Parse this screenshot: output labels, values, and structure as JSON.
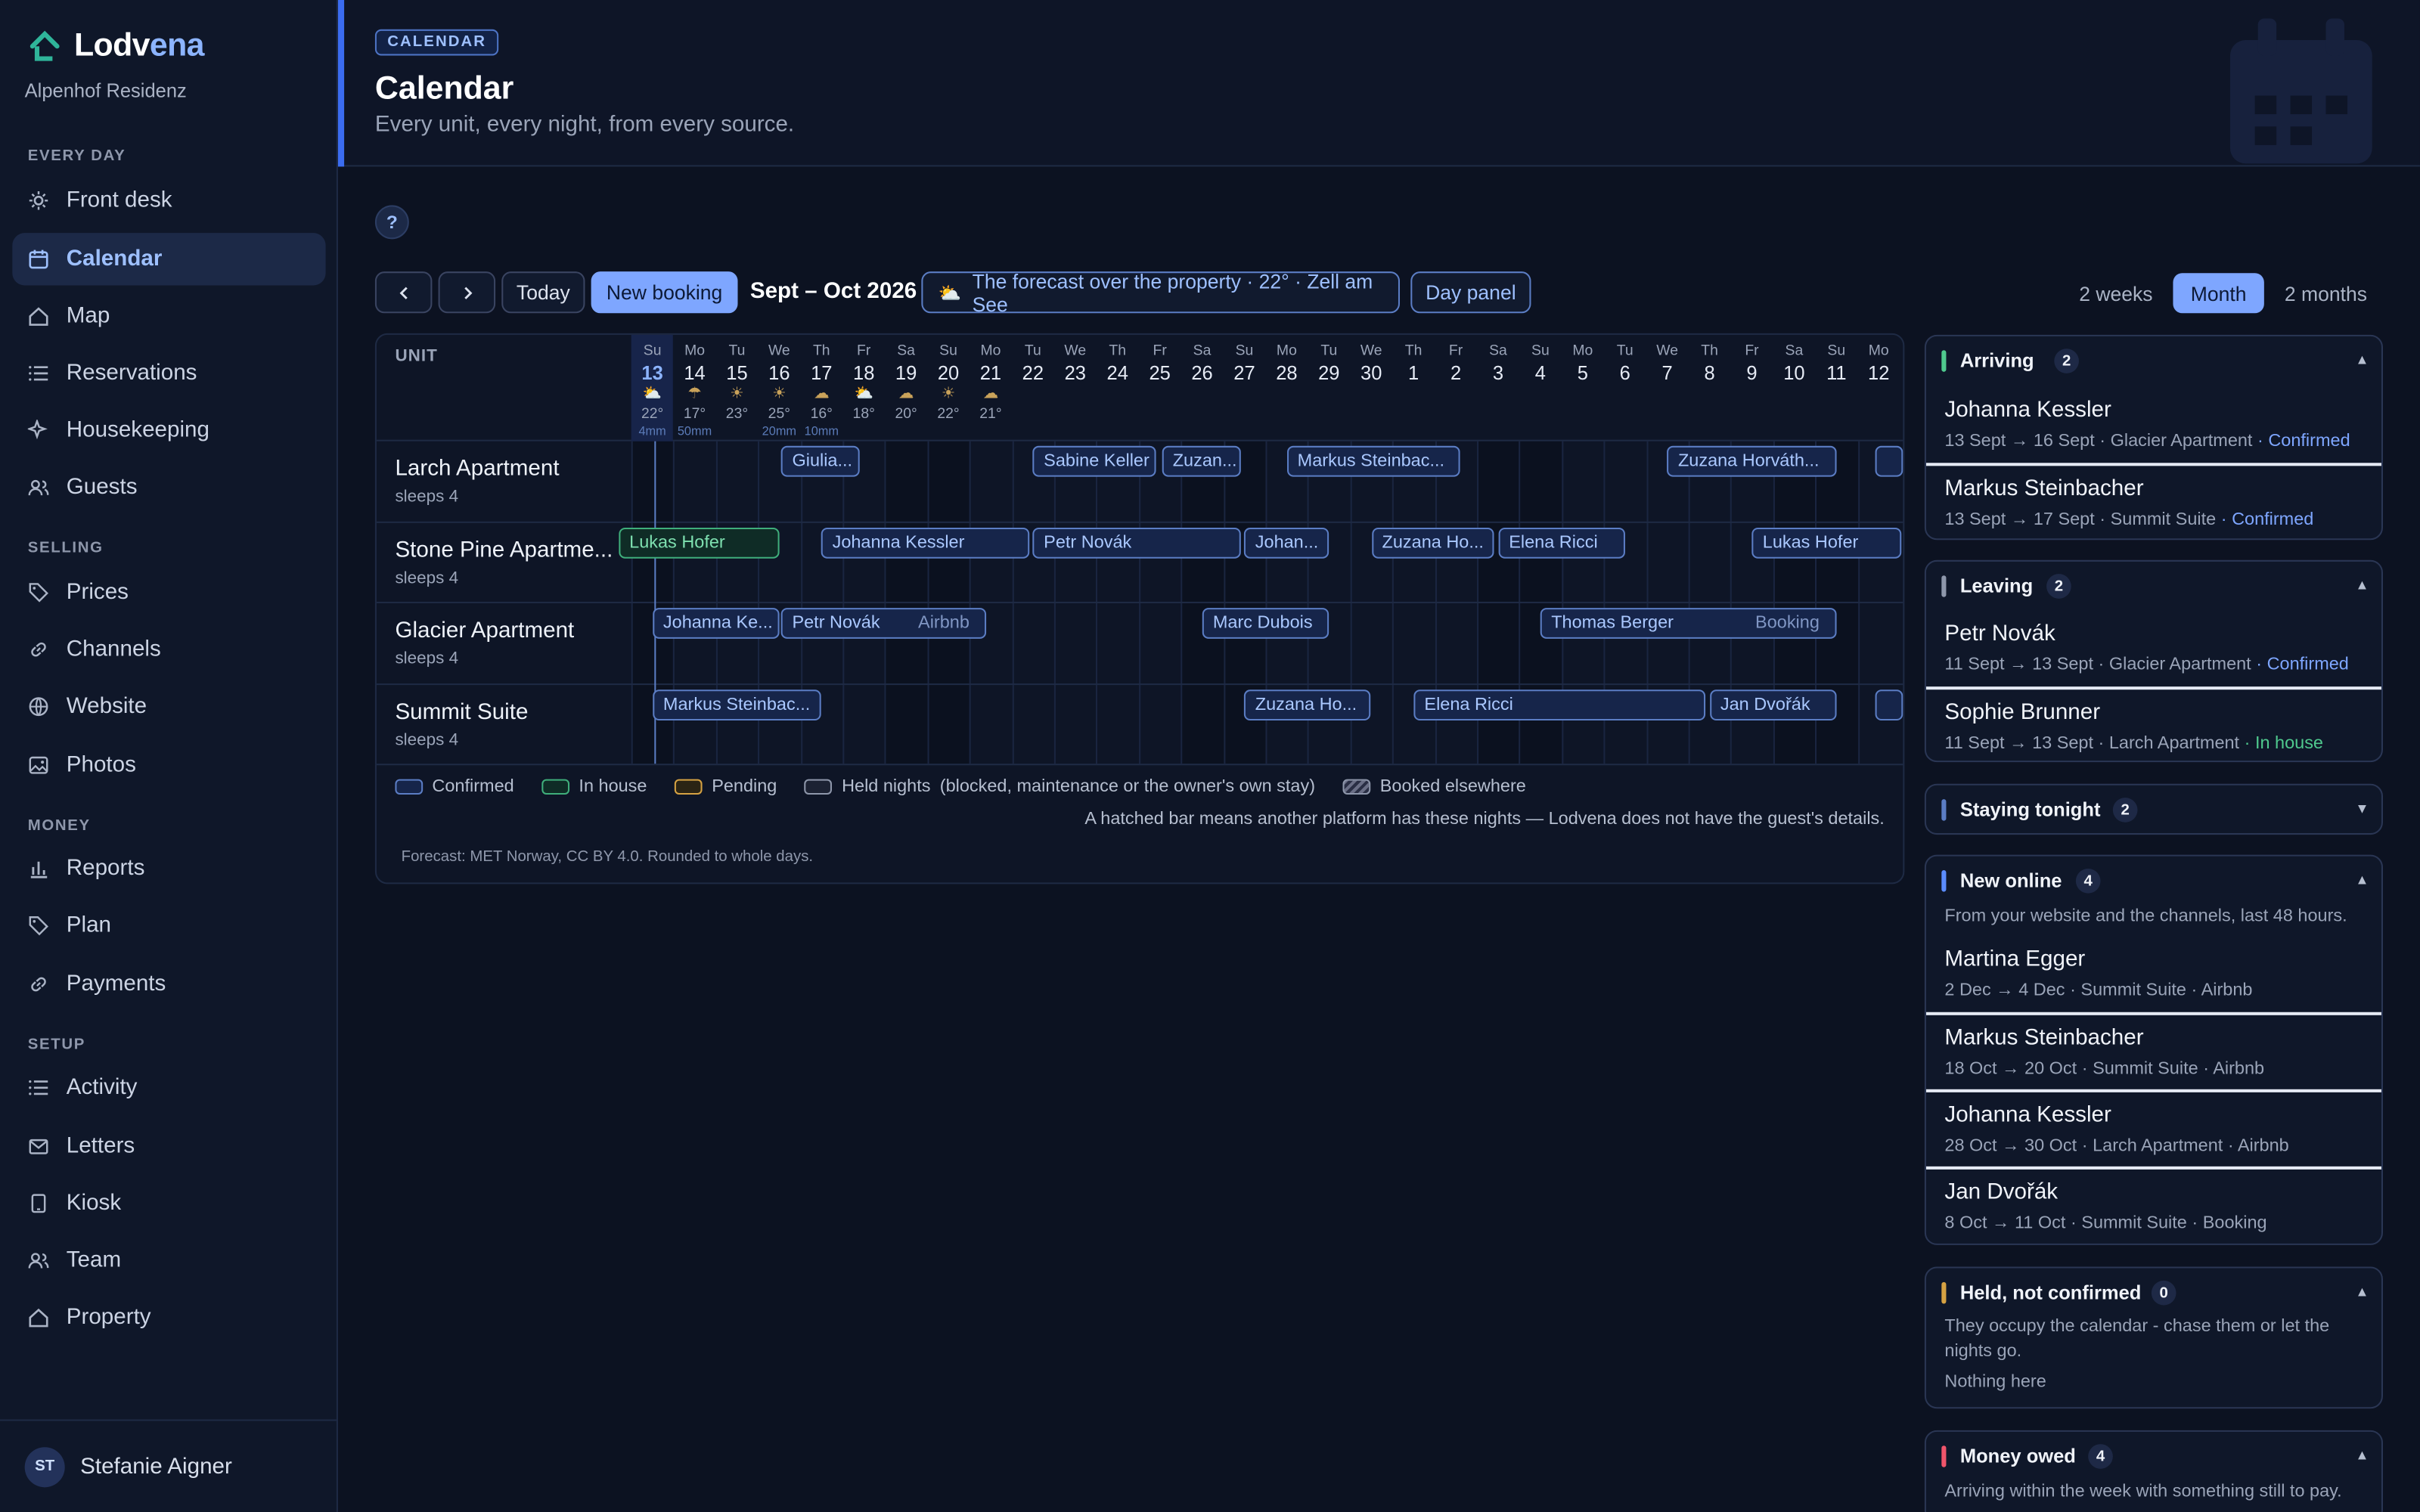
{
  "app": {
    "brand_a": "Lodv",
    "brand_b": "ena",
    "property": "Alpenhof Residenz"
  },
  "sidebar": {
    "sections": {
      "every_day": "EVERY DAY",
      "selling": "SELLING",
      "money": "MONEY",
      "setup": "SETUP"
    },
    "items": [
      {
        "label": "Front desk"
      },
      {
        "label": "Calendar"
      },
      {
        "label": "Map"
      },
      {
        "label": "Reservations"
      },
      {
        "label": "Housekeeping"
      },
      {
        "label": "Guests"
      },
      {
        "label": "Prices"
      },
      {
        "label": "Channels"
      },
      {
        "label": "Website"
      },
      {
        "label": "Photos"
      },
      {
        "label": "Reports"
      },
      {
        "label": "Plan"
      },
      {
        "label": "Payments"
      },
      {
        "label": "Activity"
      },
      {
        "label": "Letters"
      },
      {
        "label": "Kiosk"
      },
      {
        "label": "Team"
      },
      {
        "label": "Property"
      }
    ],
    "user": {
      "initials": "ST",
      "name": "Stefanie Aigner"
    }
  },
  "header": {
    "badge": "CALENDAR",
    "title": "Calendar",
    "subtitle": "Every unit, every night, from every source."
  },
  "toolbar": {
    "help": "?",
    "prev": "‹",
    "next": "›",
    "today": "Today",
    "new_booking": "New booking",
    "range": "Sept – Oct 2026",
    "forecast": "The forecast over the property · 22° · Zell am See",
    "day_panel": "Day panel",
    "views": [
      "2 weeks",
      "Month",
      "2 months"
    ],
    "selected_view": "Month"
  },
  "grid": {
    "unit_header": "UNIT",
    "days": [
      {
        "w": "Su",
        "n": "13",
        "wx": "⛅",
        "t": "22°",
        "p": "4mm"
      },
      {
        "w": "Mo",
        "n": "14",
        "wx": "☂",
        "t": "17°",
        "p": "50mm"
      },
      {
        "w": "Tu",
        "n": "15",
        "wx": "☀",
        "t": "23°",
        "p": ""
      },
      {
        "w": "We",
        "n": "16",
        "wx": "☀",
        "t": "25°",
        "p": "20mm"
      },
      {
        "w": "Th",
        "n": "17",
        "wx": "☁",
        "t": "16°",
        "p": "10mm"
      },
      {
        "w": "Fr",
        "n": "18",
        "wx": "⛅",
        "t": "18°",
        "p": ""
      },
      {
        "w": "Sa",
        "n": "19",
        "wx": "☁",
        "t": "20°",
        "p": ""
      },
      {
        "w": "Su",
        "n": "20",
        "wx": "☀",
        "t": "22°",
        "p": ""
      },
      {
        "w": "Mo",
        "n": "21",
        "wx": "☁",
        "t": "21°",
        "p": ""
      },
      {
        "w": "Tu",
        "n": "22"
      },
      {
        "w": "We",
        "n": "23"
      },
      {
        "w": "Th",
        "n": "24"
      },
      {
        "w": "Fr",
        "n": "25"
      },
      {
        "w": "Sa",
        "n": "26"
      },
      {
        "w": "Su",
        "n": "27"
      },
      {
        "w": "Mo",
        "n": "28"
      },
      {
        "w": "Tu",
        "n": "29"
      },
      {
        "w": "We",
        "n": "30"
      },
      {
        "w": "Th",
        "n": "1"
      },
      {
        "w": "Fr",
        "n": "2"
      },
      {
        "w": "Sa",
        "n": "3"
      },
      {
        "w": "Su",
        "n": "4"
      },
      {
        "w": "Mo",
        "n": "5"
      },
      {
        "w": "Tu",
        "n": "6"
      },
      {
        "w": "We",
        "n": "7"
      },
      {
        "w": "Th",
        "n": "8"
      },
      {
        "w": "Fr",
        "n": "9"
      },
      {
        "w": "Sa",
        "n": "10"
      },
      {
        "w": "Su",
        "n": "11"
      },
      {
        "w": "Mo",
        "n": "12"
      }
    ],
    "units": [
      {
        "name": "Larch Apartment",
        "sleeps": "sleeps 4"
      },
      {
        "name": "Stone Pine Apartme...",
        "sleeps": "sleeps 4"
      },
      {
        "name": "Glacier Apartment",
        "sleeps": "sleeps 4"
      },
      {
        "name": "Summit Suite",
        "sleeps": "sleeps 4"
      }
    ],
    "bookings": [
      {
        "guest": "Giulia...",
        "source": ""
      },
      {
        "guest": "Sabine Keller",
        "source": ""
      },
      {
        "guest": "Zuzan...",
        "source": ""
      },
      {
        "guest": "Markus Steinbac...",
        "source": ""
      },
      {
        "guest": "Zuzana Horváth...",
        "source": ""
      },
      {
        "guest": "",
        "source": ""
      },
      {
        "guest": "Lukas Hofer",
        "source": ""
      },
      {
        "guest": "Johanna Kessler",
        "source": ""
      },
      {
        "guest": "Petr Novák",
        "source": ""
      },
      {
        "guest": "Johan...",
        "source": ""
      },
      {
        "guest": "Zuzana Ho...",
        "source": ""
      },
      {
        "guest": "Elena Ricci",
        "source": ""
      },
      {
        "guest": "Lukas Hofer",
        "source": ""
      },
      {
        "guest": "Johanna Ke...",
        "source": ""
      },
      {
        "guest": "Petr Novák",
        "source": "Airbnb"
      },
      {
        "guest": "Marc Dubois",
        "source": ""
      },
      {
        "guest": "Thomas Berger",
        "source": "Booking"
      },
      {
        "guest": "Markus Steinbac...",
        "source": ""
      },
      {
        "guest": "Zuzana Ho...",
        "source": ""
      },
      {
        "guest": "Elena Ricci",
        "source": ""
      },
      {
        "guest": "Jan Dvořák",
        "source": ""
      },
      {
        "guest": "",
        "source": ""
      }
    ]
  },
  "legend": {
    "confirmed": "Confirmed",
    "in_house": "In house",
    "pending": "Pending",
    "held": "Held nights",
    "held_note": "(blocked, maintenance or the owner's own stay)",
    "elsewhere": "Booked elsewhere",
    "hatch_note": "A hatched bar means another platform has these nights — Lodvena does not have the guest's details.",
    "forecast_note": "Forecast: MET Norway, CC BY 4.0. Rounded to whole days."
  },
  "panels": {
    "arriving": {
      "title": "Arriving",
      "count": "2",
      "items": [
        {
          "name": "Johanna Kessler",
          "dates": "13 Sept → 16 Sept",
          "unit": "· Glacier Apartment",
          "status": "· Confirmed"
        },
        {
          "name": "Markus Steinbacher",
          "dates": "13 Sept → 17 Sept",
          "unit": "· Summit Suite",
          "status": "· Confirmed"
        }
      ]
    },
    "leaving": {
      "title": "Leaving",
      "count": "2",
      "items": [
        {
          "name": "Petr Novák",
          "dates": "11 Sept → 13 Sept",
          "unit": "· Glacier Apartment",
          "status": "· Confirmed"
        },
        {
          "name": "Sophie Brunner",
          "dates": "11 Sept → 13 Sept",
          "unit": "· Larch Apartment",
          "status": "· In house"
        }
      ]
    },
    "staying": {
      "title": "Staying tonight",
      "count": "2"
    },
    "new_online": {
      "title": "New online",
      "count": "4",
      "desc": "From your website and the channels, last 48 hours.",
      "items": [
        {
          "name": "Martina Egger",
          "dates": "2 Dec → 4 Dec",
          "unit": "· Summit Suite",
          "source": "· Airbnb"
        },
        {
          "name": "Markus Steinbacher",
          "dates": "18 Oct → 20 Oct",
          "unit": "· Summit Suite",
          "source": "· Airbnb"
        },
        {
          "name": "Johanna Kessler",
          "dates": "28 Oct → 30 Oct",
          "unit": "· Larch Apartment",
          "source": "· Airbnb"
        },
        {
          "name": "Jan Dvořák",
          "dates": "8 Oct → 11 Oct",
          "unit": "· Summit Suite",
          "source": "· Booking"
        }
      ]
    },
    "held": {
      "title": "Held, not confirmed",
      "count": "0",
      "desc": "They occupy the calendar - chase them or let the nights go.",
      "empty": "Nothing here"
    },
    "owed": {
      "title": "Money owed",
      "count": "4",
      "desc": "Arriving within the week with something still to pay."
    }
  },
  "colors": {
    "accent": "#7ea6ff",
    "confirmed": "#5b7dc4",
    "in_house": "#3fae7b",
    "pending": "#d6a243",
    "held": "#8e97ab",
    "money": "#f0556b"
  }
}
